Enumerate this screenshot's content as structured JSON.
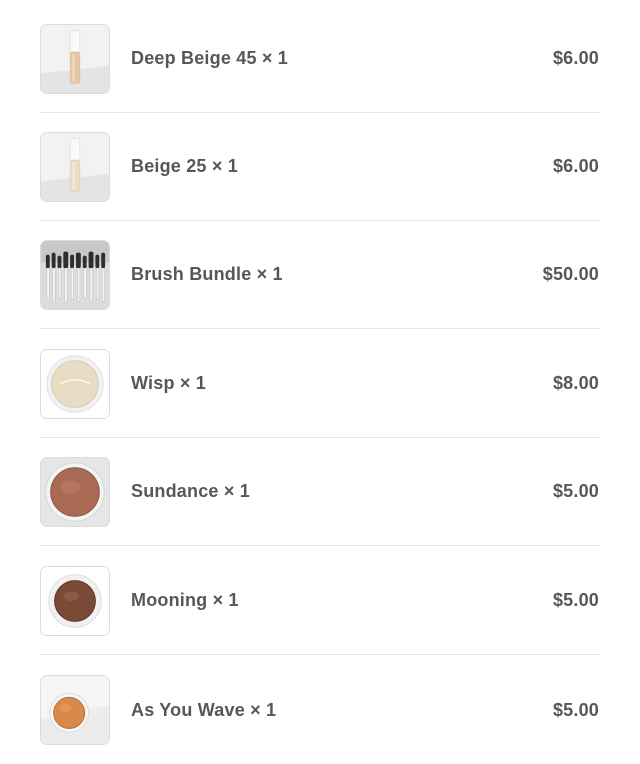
{
  "order_items": [
    {
      "name": "Deep Beige 45 × 1",
      "price": "$6.00",
      "image": "concealer-tube-deep-beige"
    },
    {
      "name": "Beige 25 × 1",
      "price": "$6.00",
      "image": "concealer-tube-beige"
    },
    {
      "name": "Brush Bundle × 1",
      "price": "$50.00",
      "image": "makeup-brush-set"
    },
    {
      "name": "Wisp × 1",
      "price": "$8.00",
      "image": "highlighter-pan-wisp"
    },
    {
      "name": "Sundance × 1",
      "price": "$5.00",
      "image": "shadow-pan-sundance"
    },
    {
      "name": "Mooning × 1",
      "price": "$5.00",
      "image": "shadow-pan-mooning"
    },
    {
      "name": "As You Wave × 1",
      "price": "$5.00",
      "image": "shadow-pan-as-you-wave"
    }
  ],
  "colors": {
    "text": "#575757",
    "divider": "#e6e6e6",
    "deep_beige": "#e6c8a8",
    "beige": "#eddcc6",
    "wisp": "#e8dcc4",
    "sundance": "#a86a52",
    "mooning": "#7a4a36",
    "as_you_wave": "#d98a4a"
  }
}
